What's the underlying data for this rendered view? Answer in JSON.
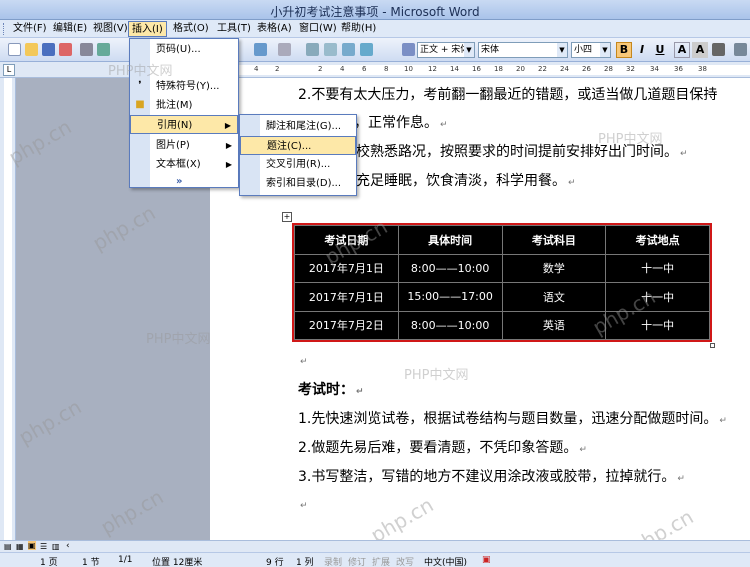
{
  "window": {
    "title": "小升初考试注意事项 - Microsoft Word"
  },
  "menubar": {
    "items": [
      "文件(F)",
      "编辑(E)",
      "视图(V)",
      "插入(I)",
      "格式(O)",
      "工具(T)",
      "表格(A)",
      "窗口(W)",
      "帮助(H)"
    ]
  },
  "toolbar": {
    "style_value": "正文 + 宋体",
    "font_value": "宋体",
    "size_value": "小四",
    "bold_label": "B",
    "italic_label": "I",
    "underline_label": "U",
    "fontcolor_label": "A"
  },
  "ruler": {
    "corner": "L",
    "numbers": [
      "4",
      "2",
      "2",
      "4",
      "6",
      "8",
      "10",
      "12",
      "14",
      "16",
      "18",
      "20",
      "22",
      "24",
      "26",
      "28",
      "32",
      "34",
      "36",
      "38"
    ]
  },
  "insert_menu": {
    "items": [
      {
        "label": "页码(U)..."
      },
      {
        "label": "特殊符号(Y)..."
      },
      {
        "label": "批注(M)"
      },
      {
        "label": "引用(N)",
        "has_submenu": true
      },
      {
        "label": "图片(P)",
        "has_submenu": true
      },
      {
        "label": "文本框(X)",
        "has_submenu": true
      }
    ],
    "expand_label": "»"
  },
  "reference_submenu": {
    "items": [
      {
        "label": "脚注和尾注(G)..."
      },
      {
        "label": "题注(C)..."
      },
      {
        "label": "交叉引用(R)..."
      },
      {
        "label": "索引和目录(D)..."
      }
    ]
  },
  "document": {
    "line1": "2.不要有太大压力，考前翻一翻最近的错题，或适当做几道题目保持",
    "line2_visible": "状态即可，正常作息。",
    "line3_visible": "学校熟悉路况，按照要求的时间提前安排好出门时间。",
    "line4_visible": "证充足睡眠，饮食清淡，科学用餐。",
    "heading": "考试时：",
    "tips": [
      "1.先快速浏览试卷，根据试卷结构与题目数量，迅速分配做题时间。",
      "2.做题先易后难，要看清题，不凭印象答题。",
      "3.书写整洁，写错的地方不建议用涂改液或胶带，拉掉就行。"
    ],
    "pilcrow": "↵"
  },
  "exam_table": {
    "headers": [
      "考试日期",
      "具体时间",
      "考试科目",
      "考试地点"
    ],
    "rows": [
      [
        "2017年7月1日",
        "8:00——10:00",
        "数学",
        "十一中"
      ],
      [
        "2017年7月1日",
        "15:00——17:00",
        "语文",
        "十一中"
      ],
      [
        "2017年7月2日",
        "8:00——10:00",
        "英语",
        "十一中"
      ]
    ]
  },
  "watermarks": {
    "php_cn": "php.cn",
    "php_zw": "PHP中文网"
  },
  "statusbar": {
    "page": "1 页",
    "section": "1 节",
    "pages": "1/1",
    "position": "位置 12厘米",
    "line": "9 行",
    "column": "1 列",
    "rec": "录制",
    "trk": "修订",
    "ext": "扩展",
    "ovr": "改写",
    "language": "中文(中国)"
  },
  "colors": {
    "table_border": "#d01818",
    "menu_highlight": "#fde8a8",
    "selection_border": "#5a7bbd"
  }
}
